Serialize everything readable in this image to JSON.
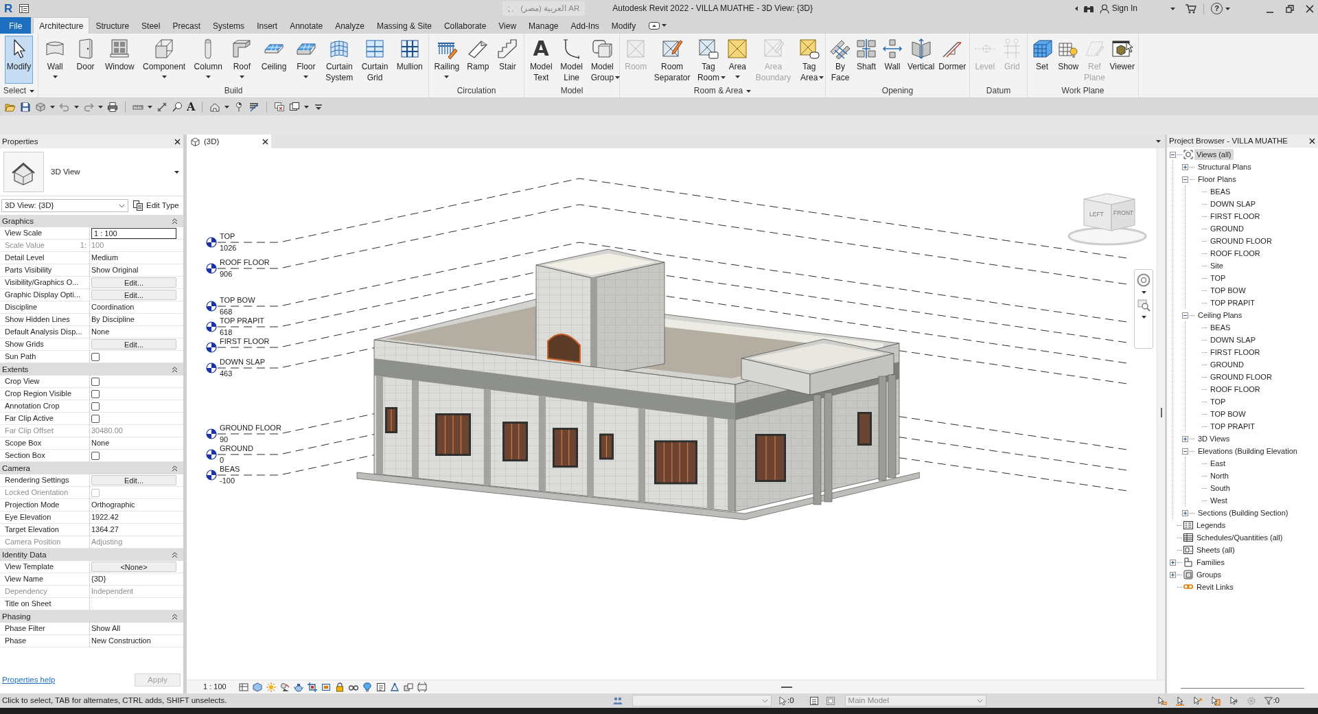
{
  "title_bar": {
    "logo": "R",
    "language": "AR العربية (مصر)",
    "title": "Autodesk Revit 2022 - VILLA MUATHE - 3D View: {3D}",
    "sign_in": "Sign In",
    "help": "?"
  },
  "ribbon": {
    "tabs": [
      {
        "label": "File",
        "kind": "menu",
        "selected": false
      },
      {
        "label": "Architecture",
        "kind": "tab",
        "selected": true
      },
      {
        "label": "Structure",
        "kind": "tab",
        "selected": false
      },
      {
        "label": "Steel",
        "kind": "tab",
        "selected": false
      },
      {
        "label": "Precast",
        "kind": "tab",
        "selected": false
      },
      {
        "label": "Systems",
        "kind": "tab",
        "selected": false
      },
      {
        "label": "Insert",
        "kind": "tab",
        "selected": false
      },
      {
        "label": "Annotate",
        "kind": "tab",
        "selected": false
      },
      {
        "label": "Analyze",
        "kind": "tab",
        "selected": false
      },
      {
        "label": "Massing & Site",
        "kind": "tab",
        "selected": false
      },
      {
        "label": "Collaborate",
        "kind": "tab",
        "selected": false
      },
      {
        "label": "View",
        "kind": "tab",
        "selected": false
      },
      {
        "label": "Manage",
        "kind": "tab",
        "selected": false
      },
      {
        "label": "Add-Ins",
        "kind": "tab",
        "selected": false
      },
      {
        "label": "Modify",
        "kind": "tab",
        "selected": false
      }
    ],
    "panels": [
      {
        "label": "Select",
        "menu": true,
        "buttons": [
          {
            "label": "Modify",
            "selected": true,
            "disabled": false,
            "dropdown": false
          }
        ]
      },
      {
        "label": "Build",
        "menu": false,
        "buttons": [
          {
            "label": "Wall",
            "selected": false,
            "disabled": false,
            "dropdown": true
          },
          {
            "label": "Door",
            "selected": false,
            "disabled": false,
            "dropdown": false
          },
          {
            "label": "Window",
            "selected": false,
            "disabled": false,
            "dropdown": false
          },
          {
            "label": "Component",
            "selected": false,
            "disabled": false,
            "dropdown": true
          },
          {
            "label": "Column",
            "selected": false,
            "disabled": false,
            "dropdown": true
          },
          {
            "label": "Roof",
            "selected": false,
            "disabled": false,
            "dropdown": true
          },
          {
            "label": "Ceiling",
            "selected": false,
            "disabled": false,
            "dropdown": false
          },
          {
            "label": "Floor",
            "selected": false,
            "disabled": false,
            "dropdown": true
          },
          {
            "label": "Curtain System",
            "selected": false,
            "disabled": false,
            "dropdown": false
          },
          {
            "label": "Curtain Grid",
            "selected": false,
            "disabled": false,
            "dropdown": false
          },
          {
            "label": "Mullion",
            "selected": false,
            "disabled": false,
            "dropdown": false
          }
        ]
      },
      {
        "label": "Circulation",
        "menu": false,
        "buttons": [
          {
            "label": "Railing",
            "selected": false,
            "disabled": false,
            "dropdown": true
          },
          {
            "label": "Ramp",
            "selected": false,
            "disabled": false,
            "dropdown": false
          },
          {
            "label": "Stair",
            "selected": false,
            "disabled": false,
            "dropdown": false
          }
        ]
      },
      {
        "label": "Model",
        "menu": false,
        "buttons": [
          {
            "label": "Model Text",
            "glyph": "A",
            "selected": false,
            "disabled": false,
            "dropdown": false
          },
          {
            "label": "Model Line",
            "selected": false,
            "disabled": false,
            "dropdown": false
          },
          {
            "label": "Model Group",
            "selected": false,
            "disabled": false,
            "dropdown": true
          }
        ]
      },
      {
        "label": "Room & Area",
        "menu": true,
        "buttons": [
          {
            "label": "Room",
            "selected": false,
            "disabled": true,
            "dropdown": false
          },
          {
            "label": "Room Separator",
            "selected": false,
            "disabled": false,
            "dropdown": false
          },
          {
            "label": "Tag Room",
            "selected": false,
            "disabled": false,
            "dropdown": true
          },
          {
            "label": "Area",
            "selected": false,
            "disabled": false,
            "dropdown": true
          },
          {
            "label": "Area Boundary",
            "selected": false,
            "disabled": true,
            "dropdown": false
          },
          {
            "label": "Tag Area",
            "selected": false,
            "disabled": false,
            "dropdown": true
          }
        ]
      },
      {
        "label": "Opening",
        "menu": false,
        "buttons": [
          {
            "label": "By Face",
            "selected": false,
            "disabled": false,
            "dropdown": false
          },
          {
            "label": "Shaft",
            "selected": false,
            "disabled": false,
            "dropdown": false
          },
          {
            "label": "Wall",
            "selected": false,
            "disabled": false,
            "dropdown": false
          },
          {
            "label": "Vertical",
            "selected": false,
            "disabled": false,
            "dropdown": false
          },
          {
            "label": "Dormer",
            "selected": false,
            "disabled": false,
            "dropdown": false
          }
        ]
      },
      {
        "label": "Datum",
        "menu": false,
        "buttons": [
          {
            "label": "Level",
            "selected": false,
            "disabled": true,
            "dropdown": false
          },
          {
            "label": "Grid",
            "selected": false,
            "disabled": true,
            "dropdown": false
          }
        ]
      },
      {
        "label": "Work Plane",
        "menu": false,
        "buttons": [
          {
            "label": "Set",
            "selected": false,
            "disabled": false,
            "dropdown": false
          },
          {
            "label": "Show",
            "selected": false,
            "disabled": false,
            "dropdown": false
          },
          {
            "label": "Ref Plane",
            "selected": false,
            "disabled": true,
            "dropdown": false
          },
          {
            "label": "Viewer",
            "selected": false,
            "disabled": false,
            "dropdown": false
          }
        ]
      }
    ]
  },
  "quick_access": {
    "glyph": "A"
  },
  "properties": {
    "title": "Properties",
    "type_name": "3D View",
    "instance": "3D View: {3D}",
    "edit_type": "Edit Type",
    "groups": [
      {
        "name": "Graphics",
        "expanded": true,
        "rows": [
          {
            "label": "View Scale",
            "kind": "field",
            "value": "1 : 100",
            "disabled": false
          },
          {
            "label": "Scale Value",
            "unit": "1:",
            "kind": "text",
            "value": "100",
            "disabled": true
          },
          {
            "label": "Detail Level",
            "kind": "text",
            "value": "Medium",
            "disabled": false
          },
          {
            "label": "Parts Visibility",
            "kind": "text",
            "value": "Show Original",
            "disabled": false
          },
          {
            "label": "Visibility/Graphics O...",
            "kind": "button",
            "value": "Edit...",
            "disabled": false
          },
          {
            "label": "Graphic Display Opti...",
            "kind": "button",
            "value": "Edit...",
            "disabled": false
          },
          {
            "label": "Discipline",
            "kind": "text",
            "value": "Coordination",
            "disabled": false
          },
          {
            "label": "Show Hidden Lines",
            "kind": "text",
            "value": "By Discipline",
            "disabled": false
          },
          {
            "label": "Default Analysis Disp...",
            "kind": "text",
            "value": "None",
            "disabled": false
          },
          {
            "label": "Show Grids",
            "kind": "button",
            "value": "Edit...",
            "disabled": false
          },
          {
            "label": "Sun Path",
            "kind": "checkbox",
            "checked": false,
            "disabled": false
          }
        ]
      },
      {
        "name": "Extents",
        "expanded": true,
        "rows": [
          {
            "label": "Crop View",
            "kind": "checkbox",
            "checked": false,
            "disabled": false
          },
          {
            "label": "Crop Region Visible",
            "kind": "checkbox",
            "checked": false,
            "disabled": false
          },
          {
            "label": "Annotation Crop",
            "kind": "checkbox",
            "checked": false,
            "disabled": false
          },
          {
            "label": "Far Clip Active",
            "kind": "checkbox",
            "checked": false,
            "disabled": false
          },
          {
            "label": "Far Clip Offset",
            "kind": "text",
            "value": "30480.00",
            "disabled": true
          },
          {
            "label": "Scope Box",
            "kind": "text",
            "value": "None",
            "disabled": false
          },
          {
            "label": "Section Box",
            "kind": "checkbox",
            "checked": false,
            "disabled": false
          }
        ]
      },
      {
        "name": "Camera",
        "expanded": true,
        "rows": [
          {
            "label": "Rendering Settings",
            "kind": "button",
            "value": "Edit...",
            "disabled": false
          },
          {
            "label": "Locked Orientation",
            "kind": "checkbox",
            "checked": false,
            "disabled": true
          },
          {
            "label": "Projection Mode",
            "kind": "text",
            "value": "Orthographic",
            "disabled": false
          },
          {
            "label": "Eye Elevation",
            "kind": "text",
            "value": "1922.42",
            "disabled": false
          },
          {
            "label": "Target Elevation",
            "kind": "text",
            "value": "1364.27",
            "disabled": false
          },
          {
            "label": "Camera Position",
            "kind": "text",
            "value": "Adjusting",
            "disabled": true
          }
        ]
      },
      {
        "name": "Identity Data",
        "expanded": true,
        "rows": [
          {
            "label": "View Template",
            "kind": "button",
            "value": "<None>",
            "disabled": false
          },
          {
            "label": "View Name",
            "kind": "text",
            "value": "{3D}",
            "disabled": false
          },
          {
            "label": "Dependency",
            "kind": "text",
            "value": "Independent",
            "disabled": true
          },
          {
            "label": "Title on Sheet",
            "kind": "text",
            "disabled": false
          }
        ]
      },
      {
        "name": "Phasing",
        "expanded": true,
        "rows": [
          {
            "label": "Phase Filter",
            "kind": "text",
            "value": "Show All",
            "disabled": false
          },
          {
            "label": "Phase",
            "kind": "text",
            "value": "New Construction",
            "disabled": false
          }
        ]
      }
    ],
    "help": "Properties help",
    "apply": {
      "label": "Apply",
      "disabled": true
    }
  },
  "view": {
    "tab": "(3D)",
    "levels": [
      {
        "name": "TOP",
        "elevation": "1026"
      },
      {
        "name": "ROOF FLOOR",
        "elevation": "906"
      },
      {
        "name": "TOP BOW",
        "elevation": "668"
      },
      {
        "name": "TOP PRAPIT",
        "elevation": "618"
      },
      {
        "name": "FIRST FLOOR"
      },
      {
        "name": "DOWN SLAP",
        "elevation": "463"
      },
      {
        "name": "GROUND FLOOR",
        "elevation": "90"
      },
      {
        "name": "GROUND",
        "elevation": "0"
      },
      {
        "name": "BEAS",
        "elevation": "-100"
      }
    ],
    "view_cube": [
      "LEFT",
      "FRONT"
    ],
    "scale": "1 : 100"
  },
  "project_browser": {
    "title": "Project Browser - VILLA MUATHE",
    "tree": [
      {
        "label": "Views (all)",
        "expanded": true,
        "selected": true,
        "children": [
          {
            "label": "Structural Plans",
            "expanded": false,
            "selected": false
          },
          {
            "label": "Floor Plans",
            "expanded": true,
            "selected": false,
            "children": [
              {
                "label": "BEAS",
                "selected": false
              },
              {
                "label": "DOWN SLAP",
                "selected": false
              },
              {
                "label": "FIRST FLOOR",
                "selected": false
              },
              {
                "label": "GROUND",
                "selected": false
              },
              {
                "label": "GROUND FLOOR",
                "selected": false
              },
              {
                "label": "ROOF FLOOR",
                "selected": false
              },
              {
                "label": "Site",
                "selected": false
              },
              {
                "label": "TOP",
                "selected": false
              },
              {
                "label": "TOP BOW",
                "selected": false
              },
              {
                "label": "TOP PRAPIT",
                "selected": false
              }
            ]
          },
          {
            "label": "Ceiling Plans",
            "expanded": true,
            "selected": false,
            "children": [
              {
                "label": "BEAS",
                "selected": false
              },
              {
                "label": "DOWN SLAP",
                "selected": false
              },
              {
                "label": "FIRST FLOOR",
                "selected": false
              },
              {
                "label": "GROUND",
                "selected": false
              },
              {
                "label": "GROUND FLOOR",
                "selected": false
              },
              {
                "label": "ROOF FLOOR",
                "selected": false
              },
              {
                "label": "TOP",
                "selected": false
              },
              {
                "label": "TOP BOW",
                "selected": false
              },
              {
                "label": "TOP PRAPIT",
                "selected": false
              }
            ]
          },
          {
            "label": "3D Views",
            "expanded": false,
            "selected": false
          },
          {
            "label": "Elevations (Building Elevation",
            "expanded": true,
            "selected": false,
            "children": [
              {
                "label": "East",
                "selected": false
              },
              {
                "label": "North",
                "selected": false
              },
              {
                "label": "South",
                "selected": false
              },
              {
                "label": "West",
                "selected": false
              }
            ]
          },
          {
            "label": "Sections (Building Section)",
            "expanded": false,
            "selected": false
          }
        ]
      },
      {
        "label": "Legends",
        "selected": false
      },
      {
        "label": "Schedules/Quantities (all)",
        "selected": false
      },
      {
        "label": "Sheets (all)",
        "selected": false
      },
      {
        "label": "Families",
        "expanded": false,
        "selected": false
      },
      {
        "label": "Groups",
        "expanded": false,
        "selected": false
      },
      {
        "label": "Revit Links",
        "selected": false
      }
    ]
  },
  "status_bar": {
    "message": "Click to select, TAB for alternates, CTRL adds, SHIFT unselects.",
    "workset": {
      "disabled": true
    },
    "editable_count": ":0",
    "design_option": {
      "value": "Main Model",
      "disabled": true
    },
    "filter_count": ":0"
  }
}
